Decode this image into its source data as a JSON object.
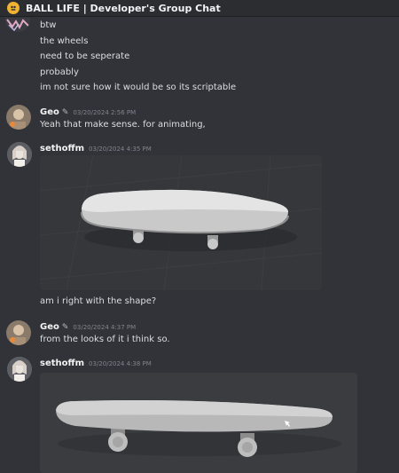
{
  "window": {
    "title": "BALL LIFE | Developer's Group Chat"
  },
  "messages": [
    {
      "lines": [
        "btw",
        "the wheels",
        "need to be seperate",
        "probably",
        "im not sure how it would be so its scriptable"
      ]
    },
    {
      "author": "Geo",
      "author_icon": "pencil-icon",
      "timestamp": "03/20/2024 2:56 PM",
      "text": "Yeah that make sense. for animating,"
    },
    {
      "author": "sethoffm",
      "timestamp": "03/20/2024 4:35 PM",
      "attachment": "skateboard-render-1",
      "text": "am i right with the shape?"
    },
    {
      "author": "Geo",
      "author_icon": "pencil-icon",
      "timestamp": "03/20/2024 4:37 PM",
      "text": "from the looks of it i think so."
    },
    {
      "author": "sethoffm",
      "timestamp": "03/20/2024 4:38 PM",
      "attachment": "skateboard-render-2"
    }
  ],
  "colors": {
    "background": "#313338",
    "text": "#dbdee1",
    "timestamp": "#80848e",
    "accent": "#f0b232"
  }
}
